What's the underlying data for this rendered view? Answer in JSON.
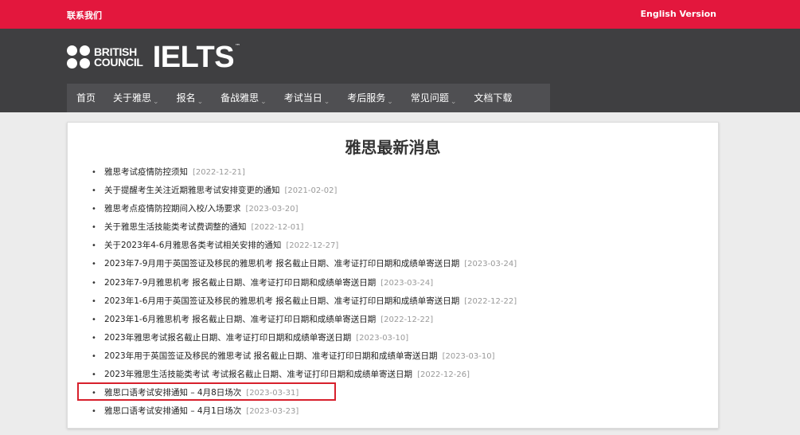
{
  "topbar": {
    "contact_label": "联系我们",
    "english_label": "English Version",
    "accent_color": "#e3173d"
  },
  "header": {
    "brand_line1": "BRITISH",
    "brand_line2": "COUNCIL",
    "product": "IELTS",
    "trademark": "™"
  },
  "nav": {
    "items": [
      {
        "label": "首页",
        "dropdown": false
      },
      {
        "label": "关于雅思",
        "dropdown": true
      },
      {
        "label": "报名",
        "dropdown": true
      },
      {
        "label": "备战雅思",
        "dropdown": true
      },
      {
        "label": "考试当日",
        "dropdown": true
      },
      {
        "label": "考后服务",
        "dropdown": true
      },
      {
        "label": "常见问题",
        "dropdown": true
      },
      {
        "label": "文档下载",
        "dropdown": false
      }
    ]
  },
  "main": {
    "title": "雅思最新消息",
    "news": [
      {
        "title": "雅思考试疫情防控须知",
        "date": "[2022-12-21]"
      },
      {
        "title": "关于提醒考生关注近期雅思考试安排变更的通知",
        "date": "[2021-02-02]"
      },
      {
        "title": "雅思考点疫情防控期间入校/入场要求",
        "date": "[2023-03-20]"
      },
      {
        "title": "关于雅思生活技能类考试费调整的通知",
        "date": "[2022-12-01]"
      },
      {
        "title": "关于2023年4-6月雅思各类考试相关安排的通知",
        "date": "[2022-12-27]"
      },
      {
        "title": "2023年7-9月用于英国签证及移民的雅思机考 报名截止日期、准考证打印日期和成绩单寄送日期",
        "date": "[2023-03-24]"
      },
      {
        "title": "2023年7-9月雅思机考 报名截止日期、准考证打印日期和成绩单寄送日期",
        "date": "[2023-03-24]"
      },
      {
        "title": "2023年1-6月用于英国签证及移民的雅思机考 报名截止日期、准考证打印日期和成绩单寄送日期",
        "date": "[2022-12-22]"
      },
      {
        "title": "2023年1-6月雅思机考 报名截止日期、准考证打印日期和成绩单寄送日期",
        "date": "[2022-12-22]"
      },
      {
        "title": "2023年雅思考试报名截止日期、准考证打印日期和成绩单寄送日期",
        "date": "[2023-03-10]"
      },
      {
        "title": "2023年用于英国签证及移民的雅思考试 报名截止日期、准考证打印日期和成绩单寄送日期",
        "date": "[2023-03-10]"
      },
      {
        "title": "2023年雅思生活技能类考试 考试报名截止日期、准考证打印日期和成绩单寄送日期",
        "date": "[2022-12-26]"
      },
      {
        "title": "雅思口语考试安排通知 – 4月8日场次",
        "date": "[2023-03-31]"
      },
      {
        "title": "雅思口语考试安排通知 – 4月1日场次",
        "date": "[2023-03-23]"
      }
    ]
  }
}
